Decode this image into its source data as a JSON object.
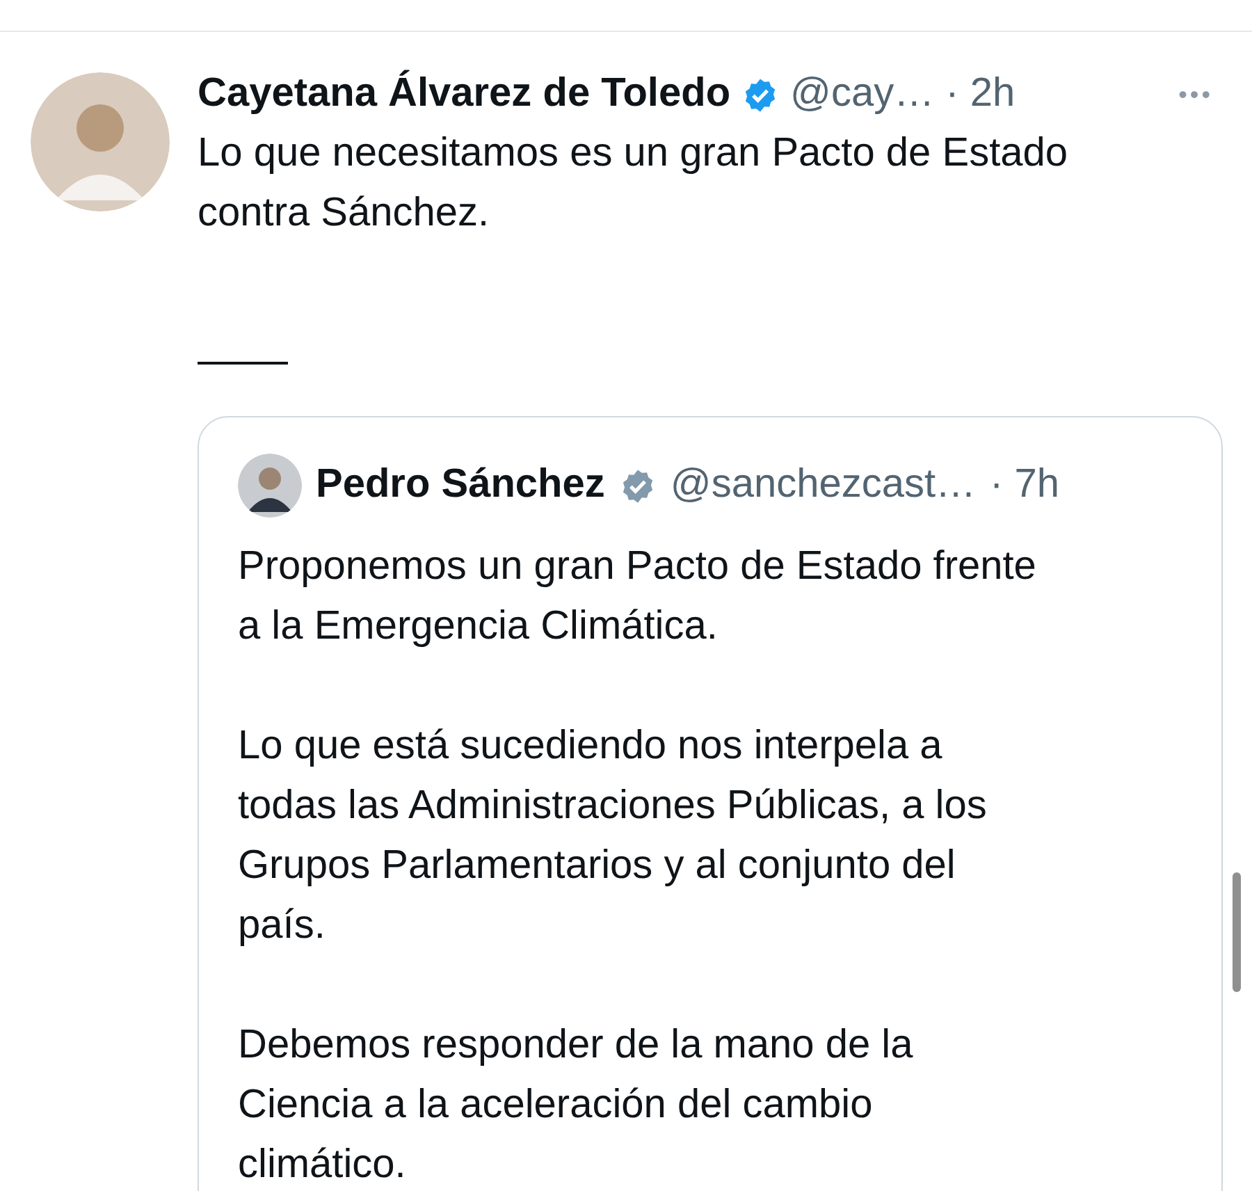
{
  "post": {
    "author": "Cayetana Álvarez de Toledo",
    "verified_badge": {
      "kind": "blue"
    },
    "handle": "@cay…",
    "time": "· 2h",
    "more": "•••",
    "text_lines": [
      "Lo que necesitamos es un gran Pacto de Estado",
      "contra Sánchez."
    ]
  },
  "quoted_post": {
    "author": "Pedro Sánchez",
    "verified_badge": {
      "kind": "gray"
    },
    "handle": "@sanchezcast…",
    "time": "· 7h",
    "paragraphs": [
      {
        "lines": [
          "Proponemos un gran Pacto de Estado frente",
          "a la Emergencia Climática."
        ]
      },
      {
        "lines": [
          "Lo que está sucediendo nos interpela a",
          "todas las Administraciones Públicas, a los",
          "Grupos Parlamentarios y al conjunto del",
          "país."
        ]
      },
      {
        "lines": [
          "Debemos responder de la mano de la",
          "Ciencia a la aceleración del cambio",
          "climático."
        ]
      }
    ]
  }
}
